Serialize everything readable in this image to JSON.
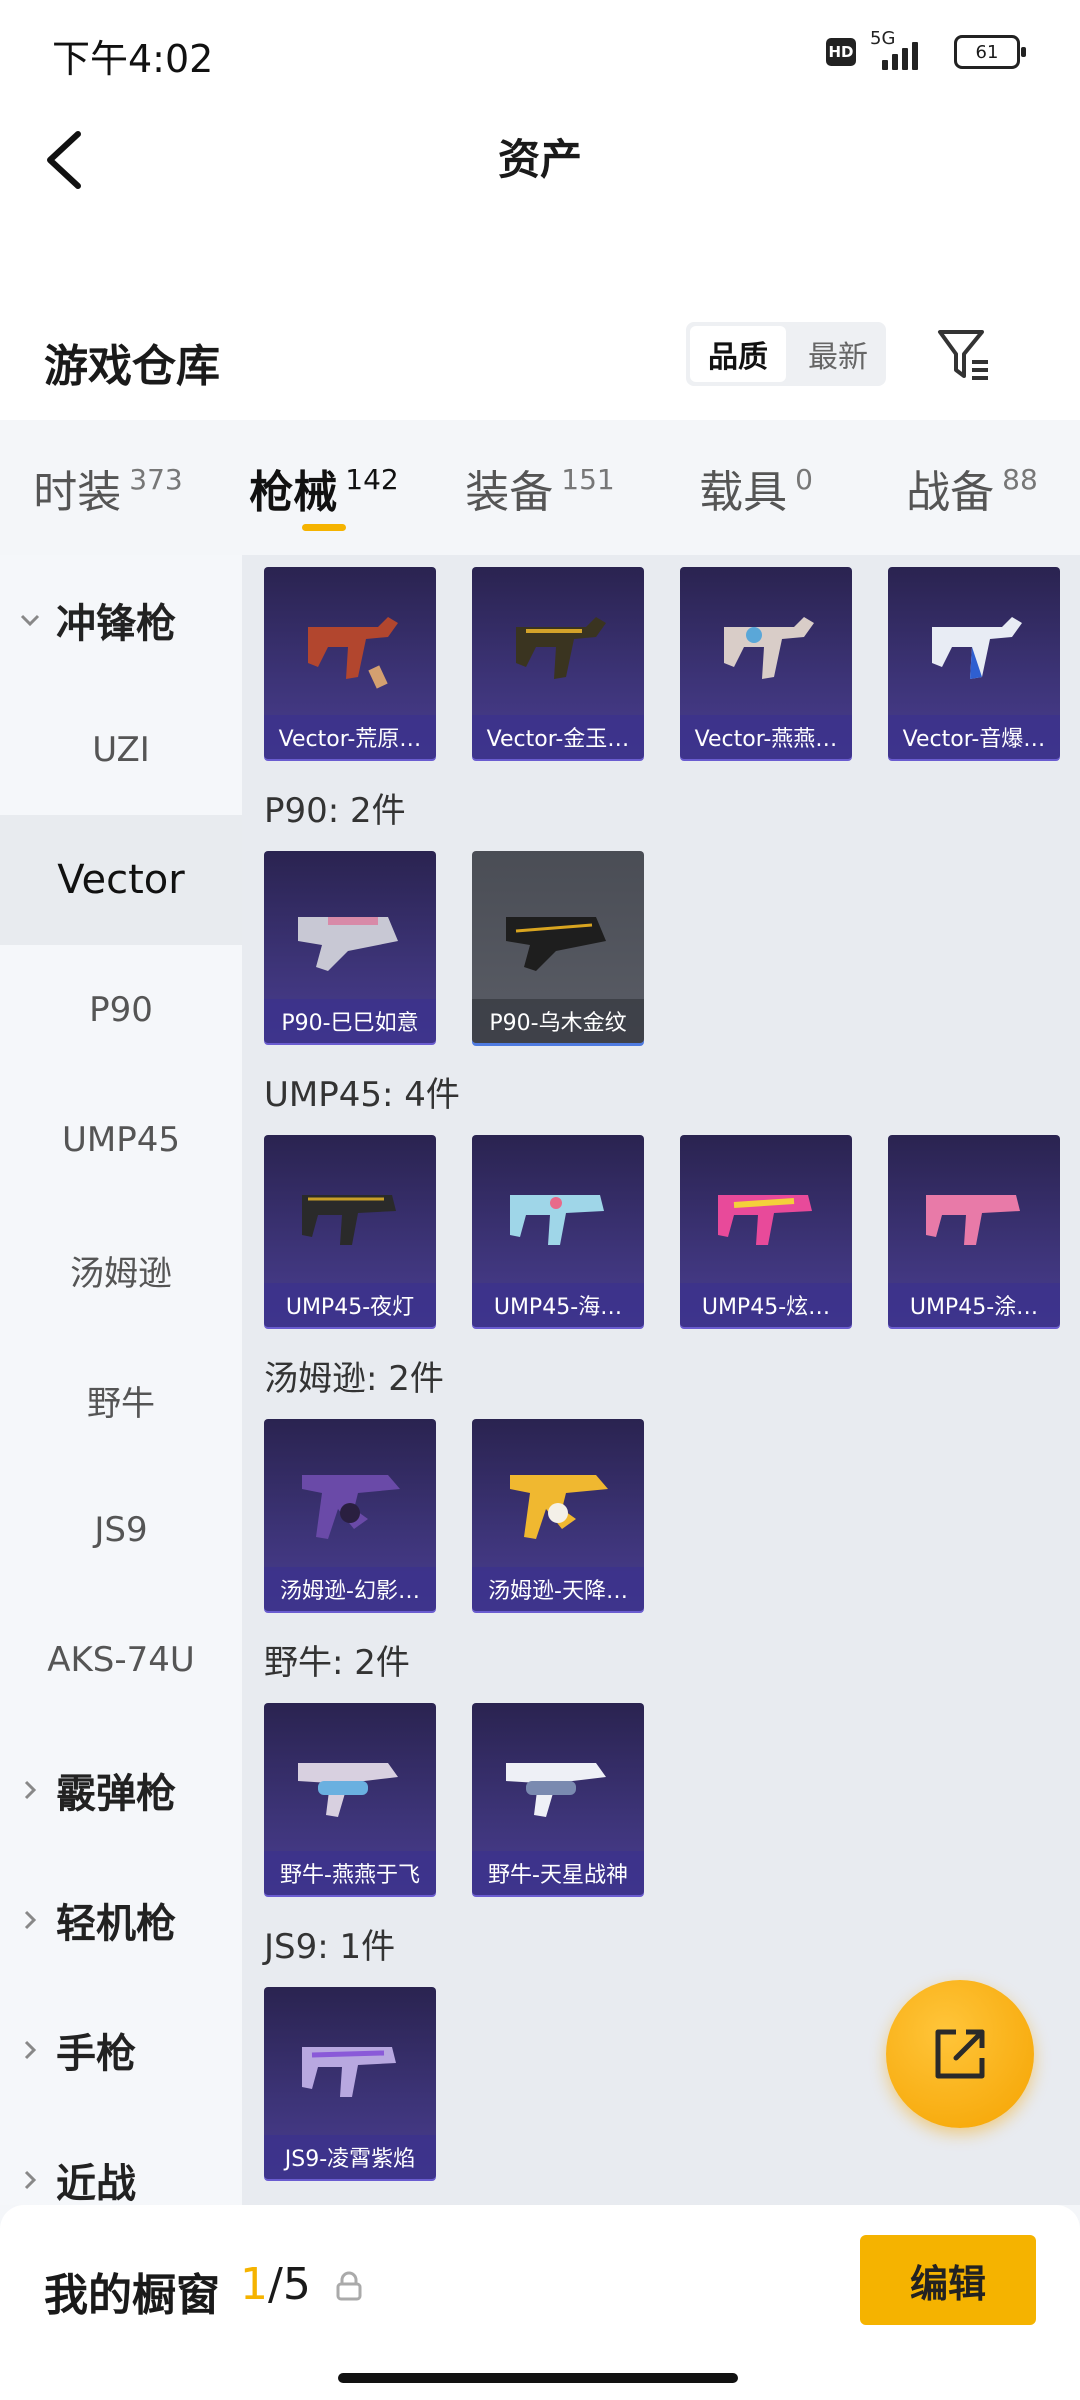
{
  "status_bar": {
    "time": "下午4:02",
    "hd": "HD",
    "network": "5G",
    "battery": "61"
  },
  "header": {
    "title": "资产"
  },
  "section": {
    "title": "游戏仓库",
    "sort_options": [
      "品质",
      "最新"
    ]
  },
  "tabs": [
    {
      "label": "时装",
      "count": "373"
    },
    {
      "label": "枪械",
      "count": "142"
    },
    {
      "label": "装备",
      "count": "151"
    },
    {
      "label": "载具",
      "count": "0"
    },
    {
      "label": "战备",
      "count": "88"
    }
  ],
  "sidebar": {
    "items": [
      {
        "label": "冲锋枪",
        "type": "category",
        "expanded": true
      },
      {
        "label": "UZI"
      },
      {
        "label": "Vector",
        "active": true
      },
      {
        "label": "P90"
      },
      {
        "label": "UMP45"
      },
      {
        "label": "汤姆逊"
      },
      {
        "label": "野牛"
      },
      {
        "label": "JS9"
      },
      {
        "label": "AKS-74U"
      },
      {
        "label": "霰弹枪",
        "type": "category"
      },
      {
        "label": "轻机枪",
        "type": "category"
      },
      {
        "label": "手枪",
        "type": "category"
      },
      {
        "label": "近战",
        "type": "category"
      }
    ]
  },
  "groups": [
    {
      "label": "",
      "items": [
        "Vector-荒原…",
        "Vector-金玉…",
        "Vector-燕燕…",
        "Vector-音爆…"
      ]
    },
    {
      "label": "P90: 2件",
      "items": [
        "P90-巳巳如意",
        "P90-乌木金纹"
      ]
    },
    {
      "label": "UMP45: 4件",
      "items": [
        "UMP45-夜灯",
        "UMP45-海…",
        "UMP45-炫…",
        "UMP45-涂…"
      ]
    },
    {
      "label": "汤姆逊: 2件",
      "items": [
        "汤姆逊-幻影…",
        "汤姆逊-天降…"
      ]
    },
    {
      "label": "野牛: 2件",
      "items": [
        "野牛-燕燕于飞",
        "野牛-天星战神"
      ]
    },
    {
      "label": "JS9: 1件",
      "items": [
        "JS9-凌霄紫焰"
      ]
    }
  ],
  "showcase": {
    "label": "我的橱窗",
    "current": "1",
    "total": "/5",
    "edit_label": "编辑"
  },
  "colors": {
    "accent": "#f5b300",
    "card_bg": "#3d3478"
  }
}
